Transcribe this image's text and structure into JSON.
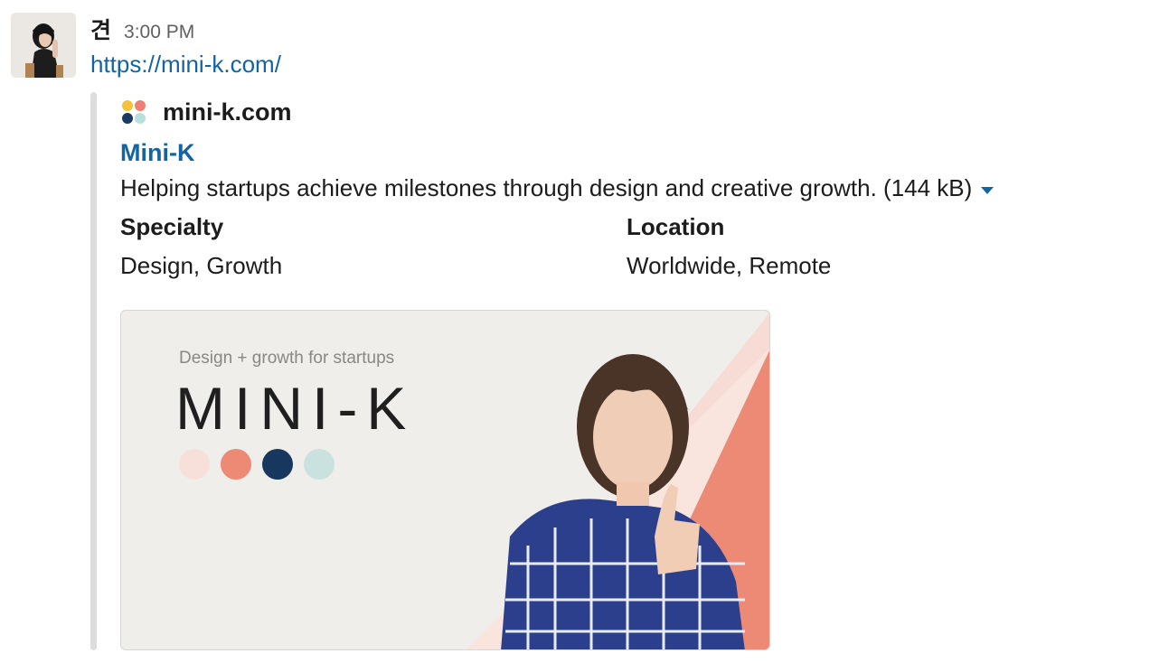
{
  "message": {
    "sender": "견",
    "timestamp": "3:00 PM",
    "link": "https://mini-k.com/"
  },
  "attachment": {
    "site_name": "mini-k.com",
    "title": "Mini-K",
    "description": "Helping startups achieve milestones through design and creative growth. (144 kB)",
    "fields": [
      {
        "title": "Specialty",
        "value": "Design, Growth"
      },
      {
        "title": "Location",
        "value": "Worldwide, Remote"
      }
    ],
    "site_icon_colors": [
      "#f5c33b",
      "#ef7f73",
      "#1a3a63",
      "#b9dede"
    ]
  },
  "preview": {
    "tagline": "Design + growth for startups",
    "brand": "MINI-K",
    "dot_colors": [
      "#f8e0da",
      "#ec8a75",
      "#17375e",
      "#c9e2df"
    ],
    "accent_color": "#ec8a75"
  },
  "colors": {
    "link": "#1264a3",
    "attachment_bar": "#dddddd"
  }
}
